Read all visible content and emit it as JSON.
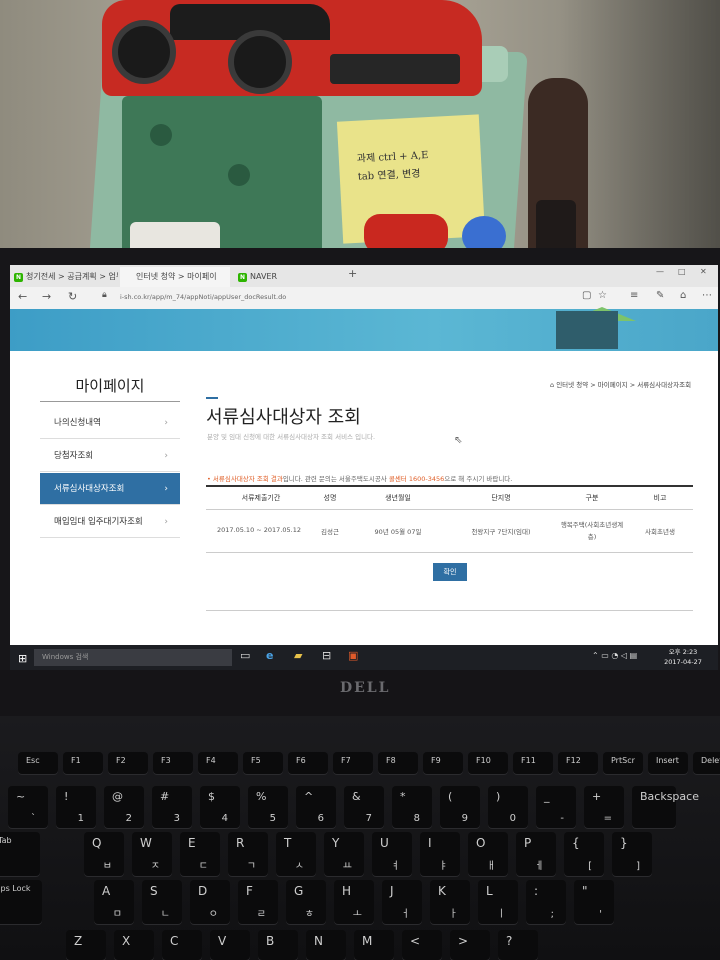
{
  "photo": {
    "sticky_note": [
      "과제 ctrl + A,E",
      "tab 연결, 변경"
    ],
    "logo": "DELL"
  },
  "browser": {
    "tabs": [
      {
        "icon": "N",
        "label": "청기전세 > 공급계획 > 업무"
      },
      {
        "icon": "",
        "label": "인터넷 청약 > 마이페이"
      },
      {
        "icon": "N",
        "label": "NAVER"
      }
    ],
    "new_tab": "+",
    "window_controls": [
      "—",
      "□",
      "✕"
    ],
    "url": "i-sh.co.kr/app/m_74/appNoti/appUser_docResult.do"
  },
  "sidebar": {
    "title": "마이페이지",
    "items": [
      {
        "label": "나의신청내역",
        "active": false
      },
      {
        "label": "당첨자조회",
        "active": false
      },
      {
        "label": "서류심사대상자조회",
        "active": true
      },
      {
        "label": "매입임대 입주대기자조회",
        "active": false
      }
    ]
  },
  "main": {
    "breadcrumb": "인터넷 청약 > 마이페이지 > 서류심사대상자조회",
    "title": "서류심사대상자 조회",
    "description": "분양 및 임대 신청에 대한 서류심사대상자 조회 서비스 입니다.",
    "notice_prefix": "• ",
    "notice_highlight": "서류심사대상자 조회 결과",
    "notice_mid": "입니다. 관련 문의는 서울주택도시공사 ",
    "notice_phone": "콜센터 1600-3456",
    "notice_suffix": "으로 해 주시기 바랍니다.",
    "table": {
      "headers": [
        "서류제출기간",
        "성명",
        "생년월일",
        "단지명",
        "구분",
        "비고"
      ],
      "rows": [
        [
          "2017.05.10 ~ 2017.05.12",
          "김성근",
          "90년 05월 07일",
          "천왕지구 7단지(임대)",
          "행복주택(사회초년생계층)",
          "사회초년생"
        ]
      ]
    },
    "confirm_label": "확인"
  },
  "taskbar": {
    "search_placeholder": "Windows 검색",
    "time": "오후 2:23",
    "date": "2017-04-27"
  },
  "keyboard": {
    "function_keys": [
      "Esc",
      "F1",
      "F2",
      "F3",
      "F4",
      "F5",
      "F6",
      "F7",
      "F8",
      "F9",
      "F10",
      "F11",
      "F12",
      "PrtScr",
      "Insert",
      "Delete"
    ],
    "number_row": [
      "~",
      "!",
      "@",
      "#",
      "$",
      "%",
      "^",
      "&",
      "*",
      "(",
      ")",
      "_",
      "+",
      "Backspace"
    ],
    "number_row_lower": [
      "`",
      "1",
      "2",
      "3",
      "4",
      "5",
      "6",
      "7",
      "8",
      "9",
      "0",
      "-",
      "="
    ],
    "q_row": [
      "Tab",
      "Q",
      "W",
      "E",
      "R",
      "T",
      "Y",
      "U",
      "I",
      "O",
      "P",
      "{",
      "}"
    ],
    "q_row_hangul": [
      "ㅂ",
      "ㅈ",
      "ㄷ",
      "ㄱ",
      "ㅅ",
      "ㅛ",
      "ㅕ",
      "ㅑ",
      "ㅐ",
      "ㅔ",
      "[",
      "]"
    ],
    "a_row": [
      "Caps Lock",
      "A",
      "S",
      "D",
      "F",
      "G",
      "H",
      "J",
      "K",
      "L",
      ":",
      "\""
    ],
    "a_row_hangul": [
      "ㅁ",
      "ㄴ",
      "ㅇ",
      "ㄹ",
      "ㅎ",
      "ㅗ",
      "ㅓ",
      "ㅏ",
      "ㅣ",
      ";",
      "'"
    ],
    "z_row": [
      "Z",
      "X",
      "C",
      "V",
      "B",
      "N",
      "M",
      "<",
      ">",
      "?"
    ]
  }
}
